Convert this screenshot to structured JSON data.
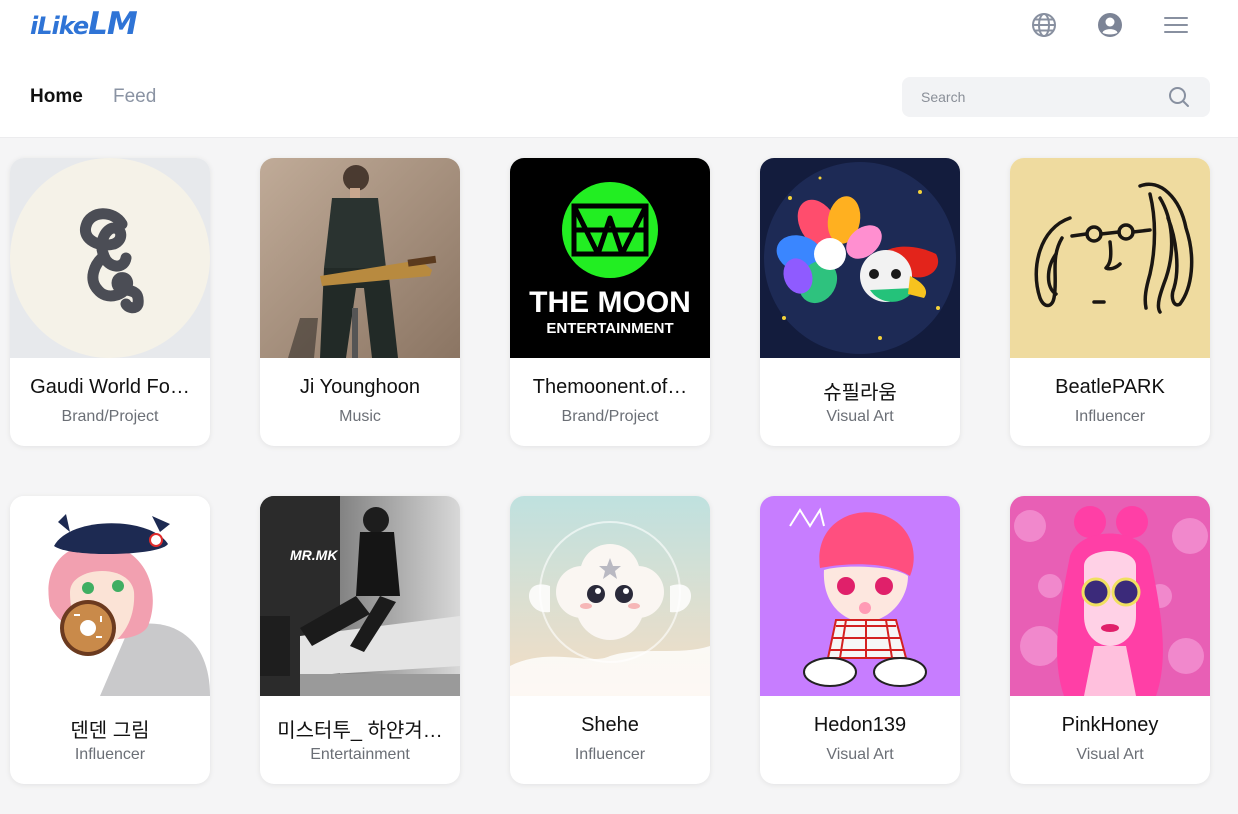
{
  "brand": {
    "logo_prefix": "iLike",
    "logo_suffix": "LM",
    "color": "#2f74d6"
  },
  "header": {
    "icons": [
      "globe-icon",
      "account-icon",
      "menu-icon"
    ],
    "tabs": [
      {
        "label": "Home",
        "active": true
      },
      {
        "label": "Feed",
        "active": false
      }
    ],
    "search": {
      "placeholder": "Search",
      "value": ""
    }
  },
  "cards": [
    {
      "name": "Gaudi World Fo…",
      "category": "Brand/Project",
      "image": "gaudi-logo-image"
    },
    {
      "name": "Ji Younghoon",
      "category": "Music",
      "image": "guitarist-photo"
    },
    {
      "name": "Themoonent.of…",
      "category": "Brand/Project",
      "image": "the-moon-logo-image",
      "image_text": [
        "THE MOON",
        "ENTERTAINMENT"
      ]
    },
    {
      "name": "슈필라움",
      "category": "Visual Art",
      "image": "rainbow-flower-illustration"
    },
    {
      "name": "BeatlePARK",
      "category": "Influencer",
      "image": "line-portrait-drawing"
    },
    {
      "name": "덴덴 그림",
      "category": "Influencer",
      "image": "pink-hair-donut-illustration"
    },
    {
      "name": "미스터투_ 하얀겨…",
      "category": "Entertainment",
      "image": "bw-man-phone-photo",
      "image_text": [
        "MR.MK"
      ]
    },
    {
      "name": "Shehe",
      "category": "Influencer",
      "image": "cute-cloud-character"
    },
    {
      "name": "Hedon139",
      "category": "Visual Art",
      "image": "pink-baby-character"
    },
    {
      "name": "PinkHoney",
      "category": "Visual Art",
      "image": "pink-hair-girl-illustration"
    }
  ]
}
